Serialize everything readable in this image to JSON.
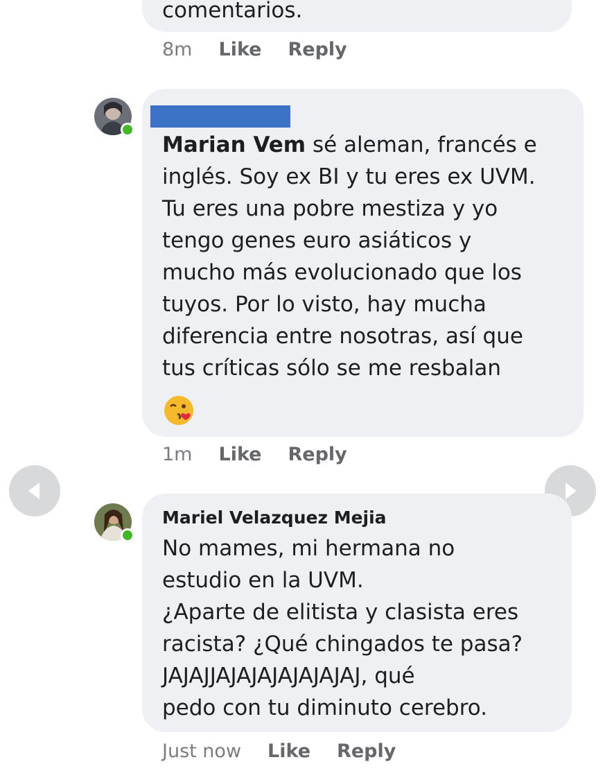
{
  "comments": [
    {
      "text_tail": "comentarios.",
      "time": "8m",
      "like_label": "Like",
      "reply_label": "Reply"
    },
    {
      "author": "Marian Vem",
      "text": " sé aleman, francés e\ninglés. Soy ex BI y tu eres ex UVM.\nTu eres una pobre mestiza y yo\ntengo genes euro asiáticos y\nmucho más evolucionado que los\ntuyos. Por lo visto, hay mucha\ndiferencia entre nosotras, así que\ntus críticas sólo se me resbalan",
      "emoji": "kissing-face-emoji",
      "time": "1m",
      "like_label": "Like",
      "reply_label": "Reply"
    },
    {
      "author": "Mariel Velazquez Mejia",
      "text": "No mames, mi hermana no\nestudio en la UVM.\n¿Aparte de elitista y clasista eres\nracista? ¿Qué chingados te pasa?\nJAJAJJAJAJAJAJAJAJAJ, qué\npedo con tu diminuto cerebro.",
      "time": "Just now",
      "like_label": "Like",
      "reply_label": "Reply"
    }
  ],
  "colors": {
    "bubble": "#eef0f3",
    "redaction": "#3d73c6",
    "online": "#42b72a",
    "nav_button": "#d8d9db"
  },
  "icons": [
    "prev-arrow-icon",
    "next-arrow-icon"
  ]
}
